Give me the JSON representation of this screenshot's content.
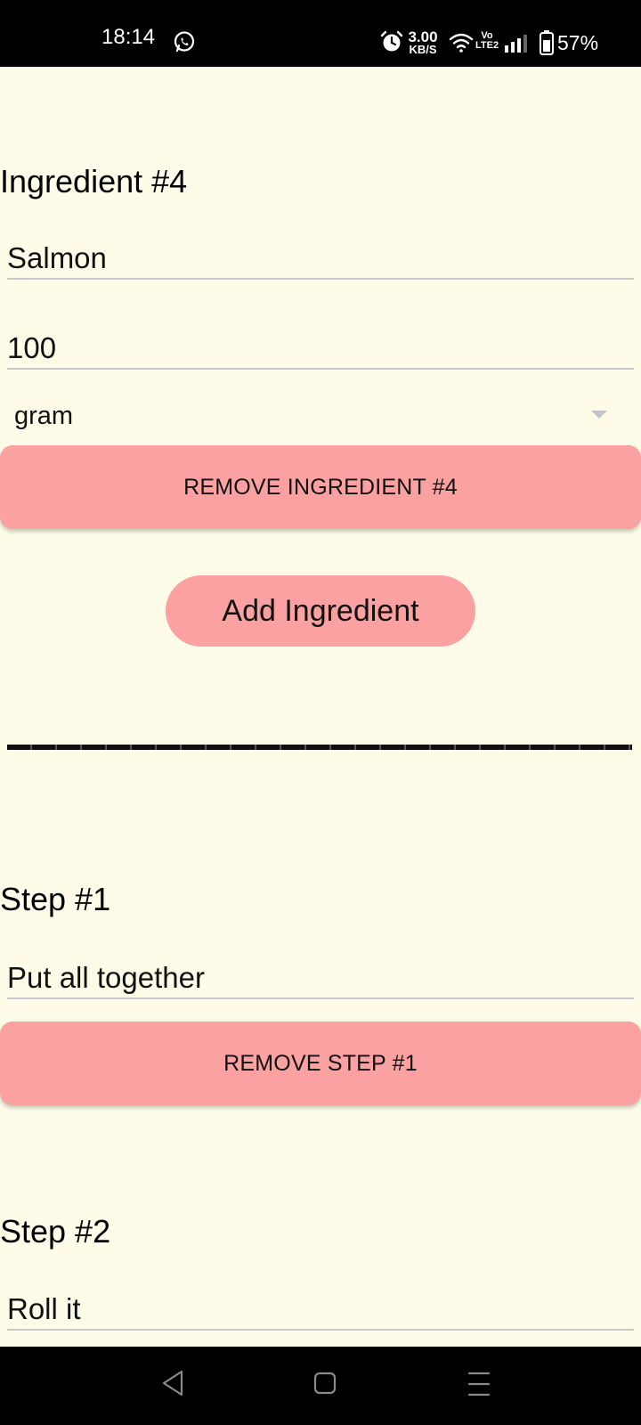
{
  "status_bar": {
    "time": "18:14",
    "net_speed_value": "3.00",
    "net_speed_unit": "KB/S",
    "network_label_top": "Vo",
    "network_label_bottom": "LTE2",
    "battery": "57%",
    "icons": [
      "whatsapp-icon",
      "alarm-icon",
      "wifi-icon",
      "signal-icon",
      "battery-icon"
    ]
  },
  "ingredient": {
    "title": "Ingredient #4",
    "name_value": "Salmon",
    "amount_value": "100",
    "unit_value": "gram",
    "remove_label": "REMOVE INGREDIENT #4"
  },
  "add_ingredient_label": "Add Ingredient",
  "steps": [
    {
      "title": "Step #1",
      "value": "Put all together",
      "remove_label": "REMOVE STEP #1"
    },
    {
      "title": "Step #2",
      "value": "Roll it"
    }
  ],
  "nav_bar": {
    "icons": [
      "back-icon",
      "home-icon",
      "recents-icon"
    ]
  },
  "colors": {
    "background": "#FEFCE8",
    "button": "#FCA1A1",
    "field_underline": "#C8C8CC",
    "system_bars": "#000000"
  }
}
